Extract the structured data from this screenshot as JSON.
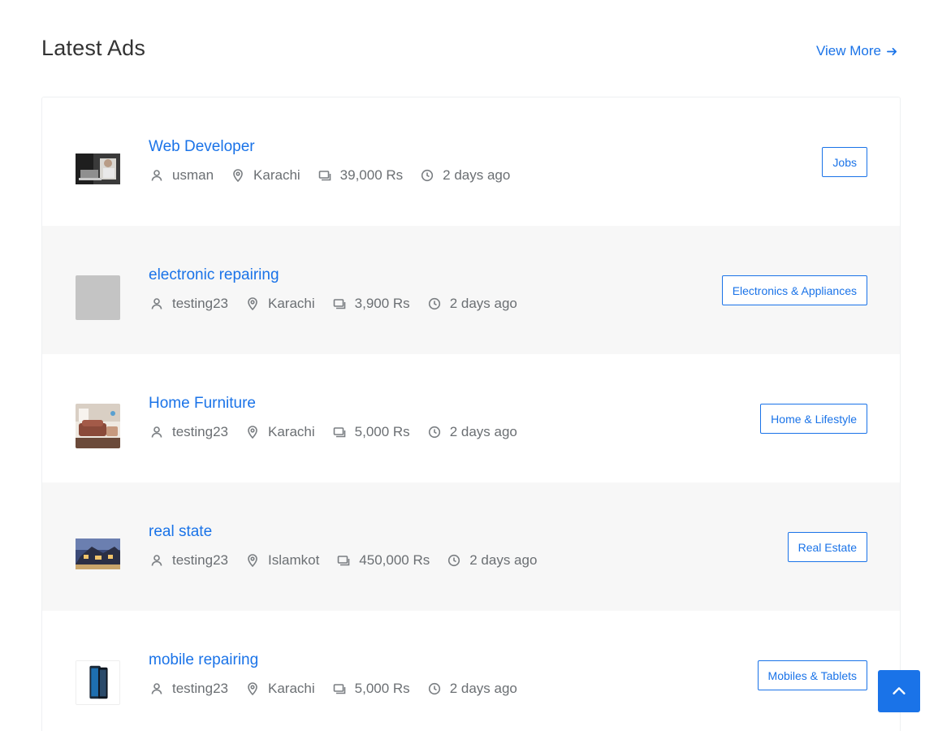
{
  "header": {
    "title": "Latest Ads",
    "view_more": "View More"
  },
  "ads": [
    {
      "title": "Web Developer",
      "user": "usman",
      "location": "Karachi",
      "price": "39,000 Rs",
      "time": "2 days ago",
      "category": "Jobs",
      "thumb": "laptop-photo"
    },
    {
      "title": "electronic repairing",
      "user": "testing23",
      "location": "Karachi",
      "price": "3,900 Rs",
      "time": "2 days ago",
      "category": "Electronics & Appliances",
      "thumb": "placeholder"
    },
    {
      "title": "Home Furniture",
      "user": "testing23",
      "location": "Karachi",
      "price": "5,000 Rs",
      "time": "2 days ago",
      "category": "Home & Lifestyle",
      "thumb": "furniture-photo"
    },
    {
      "title": "real state",
      "user": "testing23",
      "location": "Islamkot",
      "price": "450,000 Rs",
      "time": "2 days ago",
      "category": "Real Estate",
      "thumb": "house-photo"
    },
    {
      "title": "mobile repairing",
      "user": "testing23",
      "location": "Karachi",
      "price": "5,000 Rs",
      "time": "2 days ago",
      "category": "Mobiles & Tablets",
      "thumb": "phone-photo"
    }
  ],
  "colors": {
    "accent": "#1a73e8",
    "alt_row": "#f7f7f7",
    "meta_text": "#6b6f73"
  },
  "icons": {
    "user": "user-icon",
    "location": "location-pin-icon",
    "price": "price-tag-icon",
    "time": "clock-icon",
    "view_more": "arrow-right-icon",
    "scroll_top": "chevron-up-icon"
  }
}
